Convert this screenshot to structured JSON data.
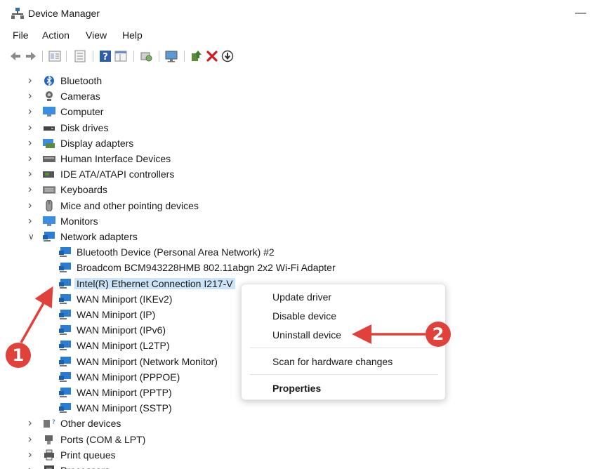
{
  "window": {
    "title": "Device Manager",
    "minimize_glyph": "—",
    "app_icon": "device-manager-icon"
  },
  "menu": {
    "items": [
      "File",
      "Action",
      "View",
      "Help"
    ]
  },
  "toolbar": {
    "icons": [
      "back-arrow-icon",
      "forward-arrow-icon",
      "properties-icon",
      "list-icon",
      "help-icon",
      "view-icon",
      "scan-icon",
      "monitor-icon",
      "update-driver-icon",
      "uninstall-icon",
      "disable-icon"
    ]
  },
  "tree": {
    "categories_top": [
      {
        "label": "Bluetooth",
        "icon": "bluetooth-icon"
      },
      {
        "label": "Cameras",
        "icon": "camera-icon"
      },
      {
        "label": "Computer",
        "icon": "computer-icon"
      },
      {
        "label": "Disk drives",
        "icon": "disk-drive-icon"
      },
      {
        "label": "Display adapters",
        "icon": "display-adapter-icon"
      },
      {
        "label": "Human Interface Devices",
        "icon": "hid-icon"
      },
      {
        "label": "IDE ATA/ATAPI controllers",
        "icon": "ide-controller-icon"
      },
      {
        "label": "Keyboards",
        "icon": "keyboard-icon"
      },
      {
        "label": "Mice and other pointing devices",
        "icon": "mouse-icon"
      },
      {
        "label": "Monitors",
        "icon": "monitor-icon"
      }
    ],
    "network": {
      "label": "Network adapters",
      "icon": "network-adapter-icon",
      "children": [
        "Bluetooth Device (Personal Area Network) #2",
        "Broadcom BCM943228HMB 802.11abgn 2x2 Wi-Fi Adapter",
        "Intel(R) Ethernet Connection I217-V",
        "WAN Miniport (IKEv2)",
        "WAN Miniport (IP)",
        "WAN Miniport (IPv6)",
        "WAN Miniport (L2TP)",
        "WAN Miniport (Network Monitor)",
        "WAN Miniport (PPPOE)",
        "WAN Miniport (PPTP)",
        "WAN Miniport (SSTP)"
      ],
      "selected_index": 2
    },
    "categories_bottom": [
      {
        "label": "Other devices",
        "icon": "other-devices-icon"
      },
      {
        "label": "Ports (COM & LPT)",
        "icon": "port-icon"
      },
      {
        "label": "Print queues",
        "icon": "printer-icon"
      },
      {
        "label": "Processors",
        "icon": "processor-icon"
      }
    ]
  },
  "context_menu": {
    "items": [
      "Update driver",
      "Disable device",
      "Uninstall device",
      "Scan for hardware changes",
      "Properties"
    ]
  },
  "annotations": {
    "badge_1": "1",
    "badge_2": "2",
    "color": "#e0413a"
  },
  "colors": {
    "selection": "#cce4f7",
    "network_icon": "#2b7cd3"
  }
}
